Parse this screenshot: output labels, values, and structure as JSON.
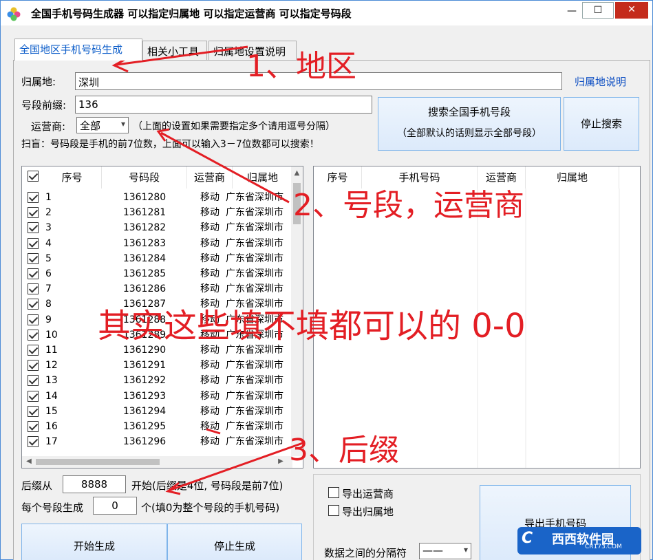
{
  "title": "全国手机号码生成器   可以指定归属地   可以指定运营商   可以指定号码段",
  "window_buttons": {
    "min": "—",
    "max": "☐",
    "close": "✕"
  },
  "tabs": [
    {
      "label": "全国地区手机号码生成",
      "active": true
    },
    {
      "label": "相关小工具",
      "active": false
    },
    {
      "label": "归属地设置说明",
      "active": false
    }
  ],
  "form": {
    "region_label": "归属地:",
    "region_value": "深圳",
    "region_link": "归属地说明",
    "prefix_label": "号段前缀:",
    "prefix_value": "136",
    "carrier_label": "运营商:",
    "carrier_value": "全部",
    "carrier_hint": "（上面的设置如果需要指定多个请用逗号分隔）",
    "note": "扫盲：号码段是手机的前7位数，上面可以输入3－7位数都可以搜索！",
    "search_button_line1": "搜索全国手机号段",
    "search_button_line2": "（全部默认的话则显示全部号段）",
    "stop_search_button": "停止搜索"
  },
  "left_table": {
    "headers": [
      "序号",
      "号码段",
      "运营商",
      "归属地"
    ],
    "rows": [
      {
        "n": "1",
        "seg": "1361280",
        "op": "移动",
        "loc": "广东省深圳市"
      },
      {
        "n": "2",
        "seg": "1361281",
        "op": "移动",
        "loc": "广东省深圳市"
      },
      {
        "n": "3",
        "seg": "1361282",
        "op": "移动",
        "loc": "广东省深圳市"
      },
      {
        "n": "4",
        "seg": "1361283",
        "op": "移动",
        "loc": "广东省深圳市"
      },
      {
        "n": "5",
        "seg": "1361284",
        "op": "移动",
        "loc": "广东省深圳市"
      },
      {
        "n": "6",
        "seg": "1361285",
        "op": "移动",
        "loc": "广东省深圳市"
      },
      {
        "n": "7",
        "seg": "1361286",
        "op": "移动",
        "loc": "广东省深圳市"
      },
      {
        "n": "8",
        "seg": "1361287",
        "op": "移动",
        "loc": "广东省深圳市"
      },
      {
        "n": "9",
        "seg": "1361288",
        "op": "移动",
        "loc": "广东省深圳市"
      },
      {
        "n": "10",
        "seg": "1361289",
        "op": "移动",
        "loc": "广东省深圳市"
      },
      {
        "n": "11",
        "seg": "1361290",
        "op": "移动",
        "loc": "广东省深圳市"
      },
      {
        "n": "12",
        "seg": "1361291",
        "op": "移动",
        "loc": "广东省深圳市"
      },
      {
        "n": "13",
        "seg": "1361292",
        "op": "移动",
        "loc": "广东省深圳市"
      },
      {
        "n": "14",
        "seg": "1361293",
        "op": "移动",
        "loc": "广东省深圳市"
      },
      {
        "n": "15",
        "seg": "1361294",
        "op": "移动",
        "loc": "广东省深圳市"
      },
      {
        "n": "16",
        "seg": "1361295",
        "op": "移动",
        "loc": "广东省深圳市"
      },
      {
        "n": "17",
        "seg": "1361296",
        "op": "移动",
        "loc": "广东省深圳市"
      }
    ]
  },
  "right_table": {
    "headers": [
      "序号",
      "手机号码",
      "运营商",
      "归属地"
    ]
  },
  "suffix": {
    "from_label": "后缀从",
    "from_value": "8888",
    "start_hint": "开始(后缀是4位, 号码段是前7位)",
    "count_label": "每个号段生成",
    "count_value": "0",
    "count_hint": "个(填0为整个号段的手机号码)",
    "start_button": "开始生成",
    "stop_button": "停止生成"
  },
  "export": {
    "carrier_checkbox": "导出运营商",
    "region_checkbox": "导出归属地",
    "separator_label": "数据之间的分隔符",
    "separator_value": "——",
    "export_button": "导出手机号码"
  },
  "annotations": {
    "a1": "1、地区",
    "a2": "2、号段，运营商",
    "a3": "3、后缀",
    "a4": "其实这些填不填都可以的  0-0"
  },
  "watermark": {
    "logo": "C",
    "name": "西西软件园",
    "site": "CR173.COM"
  },
  "colors": {
    "annotation": "#e31e24",
    "tab_active": "#0b5cc9",
    "link": "#0b4dc2",
    "button_border": "#7eb4ea"
  }
}
